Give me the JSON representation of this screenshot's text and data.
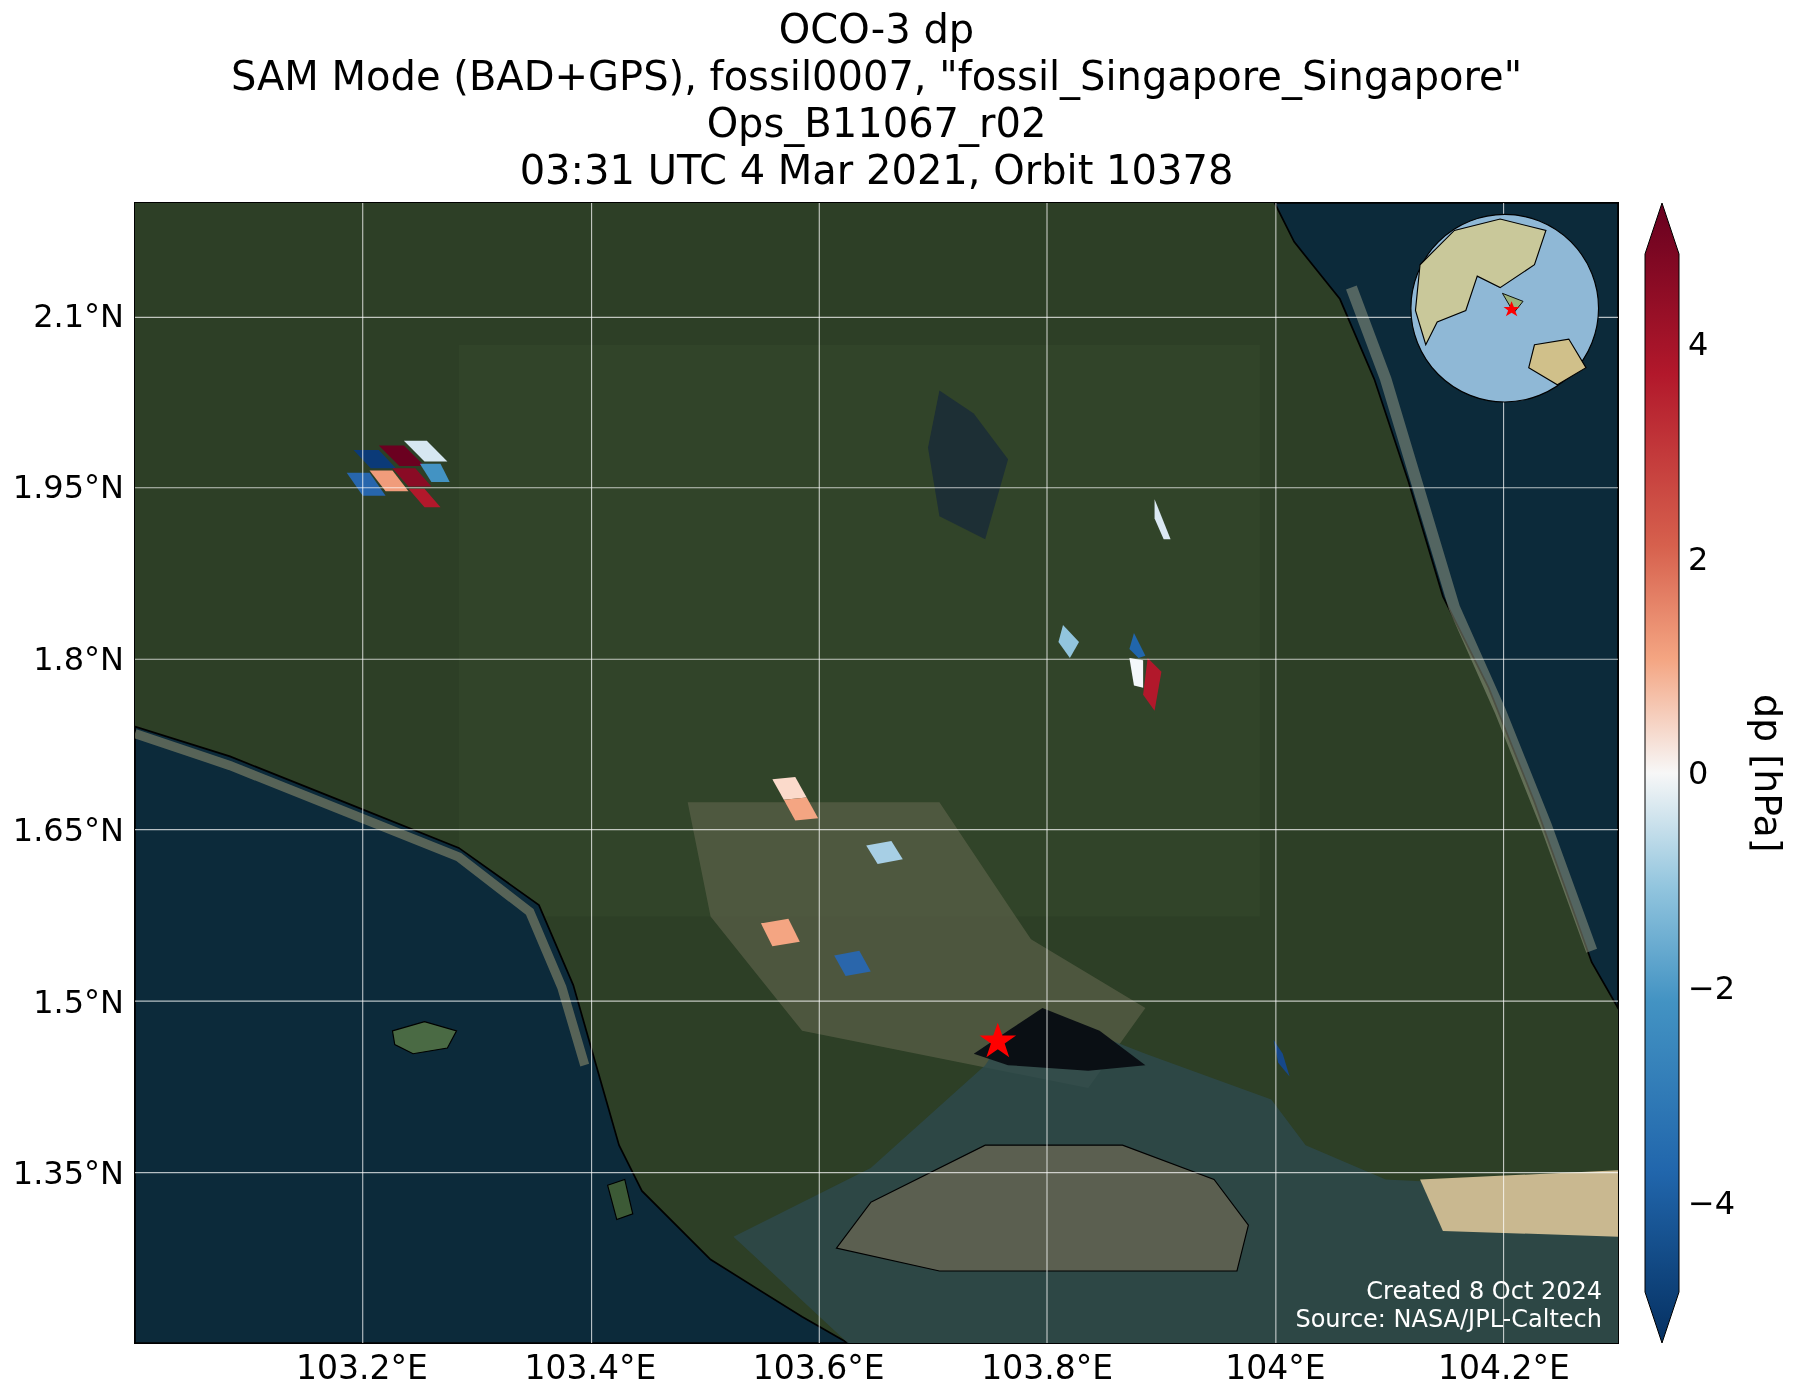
{
  "title_lines": [
    "OCO-3 dp",
    "SAM Mode (BAD+GPS), fossil0007, \"fossil_Singapore_Singapore\"",
    "Ops_B11067_r02",
    "03:31 UTC 4 Mar 2021, Orbit 10378"
  ],
  "map": {
    "lat_ticks": [
      "2.1°N",
      "1.95°N",
      "1.8°N",
      "1.65°N",
      "1.5°N",
      "1.35°N"
    ],
    "lon_ticks": [
      "103.2°E",
      "103.4°E",
      "103.6°E",
      "103.8°E",
      "104°E",
      "104.2°E"
    ],
    "credits": [
      "Created 8 Oct 2024",
      "Source: NASA/JPL-Caltech"
    ]
  },
  "colorbar": {
    "label": "dp [hPa]",
    "ticks": [
      "4",
      "2",
      "0",
      "−2",
      "−4"
    ]
  }
}
